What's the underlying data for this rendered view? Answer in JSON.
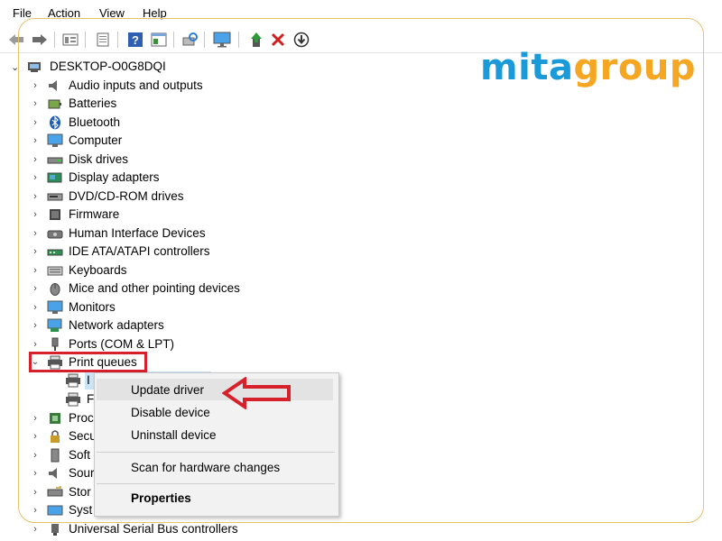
{
  "menubar": {
    "items": [
      "File",
      "Action",
      "View",
      "Help"
    ]
  },
  "toolbar": {
    "icons": [
      "back-arrow-icon",
      "forward-arrow-icon",
      "properties-icon",
      "show-hidden-icon",
      "help-icon",
      "action-view-icon",
      "scan-hardware-icon",
      "monitor-icon",
      "update-driver-icon",
      "uninstall-icon",
      "download-icon"
    ]
  },
  "brand": {
    "part1": "mita",
    "part2": "group",
    "color1": "#1a9ad8",
    "color2": "#f5a623"
  },
  "tree": {
    "root": "DESKTOP-O0G8DQI",
    "items": [
      "Audio inputs and outputs",
      "Batteries",
      "Bluetooth",
      "Computer",
      "Disk drives",
      "Display adapters",
      "DVD/CD-ROM drives",
      "Firmware",
      "Human Interface Devices",
      "IDE ATA/ATAPI controllers",
      "Keyboards",
      "Mice and other pointing devices",
      "Monitors",
      "Network adapters",
      "Ports (COM & LPT)",
      "Print queues"
    ],
    "children_visible": [
      "I",
      "F"
    ],
    "after": [
      "Proc",
      "Secu",
      "Soft",
      "Sour",
      "Stor",
      "Syst",
      "Universal Serial Bus controllers"
    ]
  },
  "context_menu": {
    "update_driver": "Update driver",
    "disable_device": "Disable device",
    "uninstall_device": "Uninstall device",
    "scan": "Scan for hardware changes",
    "properties": "Properties"
  },
  "colors": {
    "highlight_red": "#d6202c",
    "selection_blue": "#cce4f7"
  }
}
